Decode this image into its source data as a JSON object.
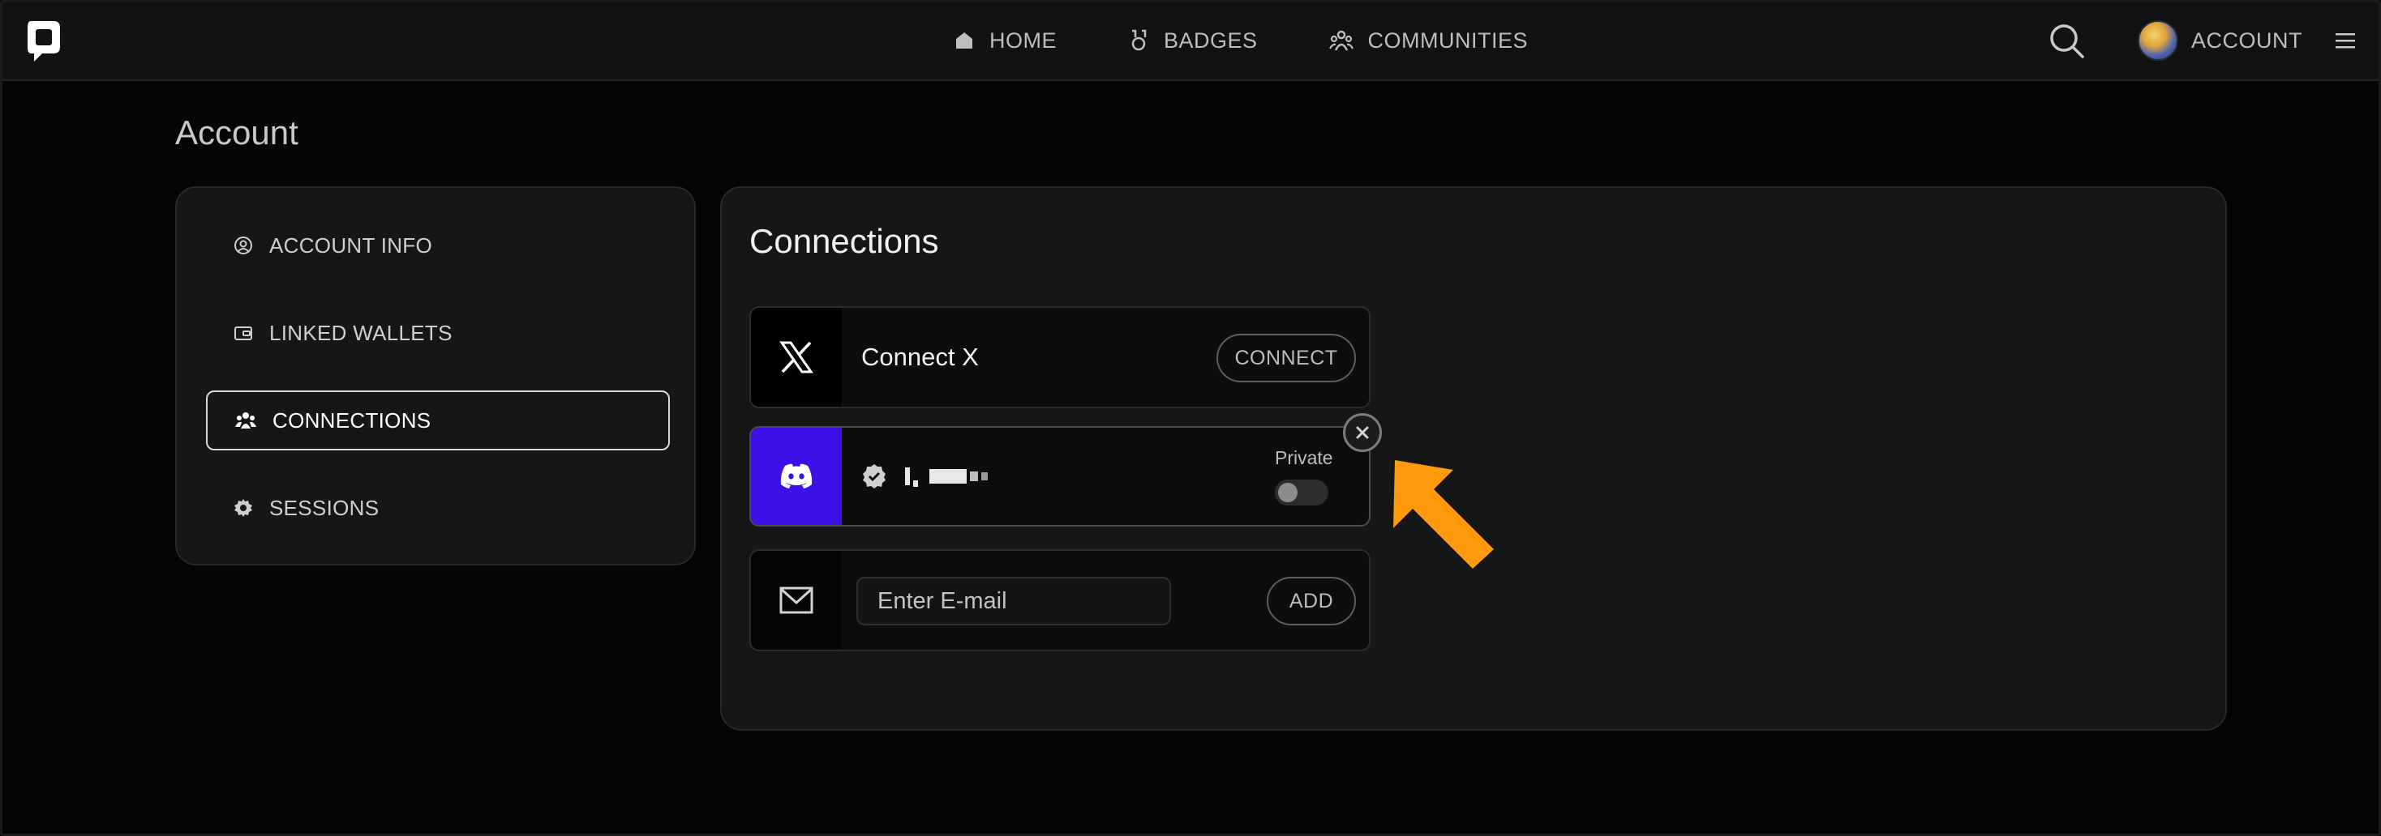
{
  "nav": {
    "items": [
      {
        "label": "HOME",
        "icon": "home-icon"
      },
      {
        "label": "BADGES",
        "icon": "badge-icon"
      },
      {
        "label": "COMMUNITIES",
        "icon": "communities-icon"
      }
    ],
    "account_label": "ACCOUNT"
  },
  "page": {
    "title": "Account"
  },
  "sidebar": {
    "items": [
      {
        "label": "ACCOUNT INFO",
        "icon": "user-circle-icon",
        "active": false
      },
      {
        "label": "LINKED WALLETS",
        "icon": "wallet-icon",
        "active": false
      },
      {
        "label": "CONNECTIONS",
        "icon": "people-icon",
        "active": true
      },
      {
        "label": "SESSIONS",
        "icon": "gear-icon",
        "active": false
      }
    ]
  },
  "connections": {
    "title": "Connections",
    "x": {
      "label": "Connect X",
      "button": "CONNECT"
    },
    "discord": {
      "private_label": "Private",
      "private_enabled": false
    },
    "email": {
      "placeholder": "Enter E-mail",
      "button": "ADD"
    }
  },
  "colors": {
    "accent_arrow": "#ff9a0e",
    "discord": "#3d10e8",
    "background": "#050505"
  }
}
